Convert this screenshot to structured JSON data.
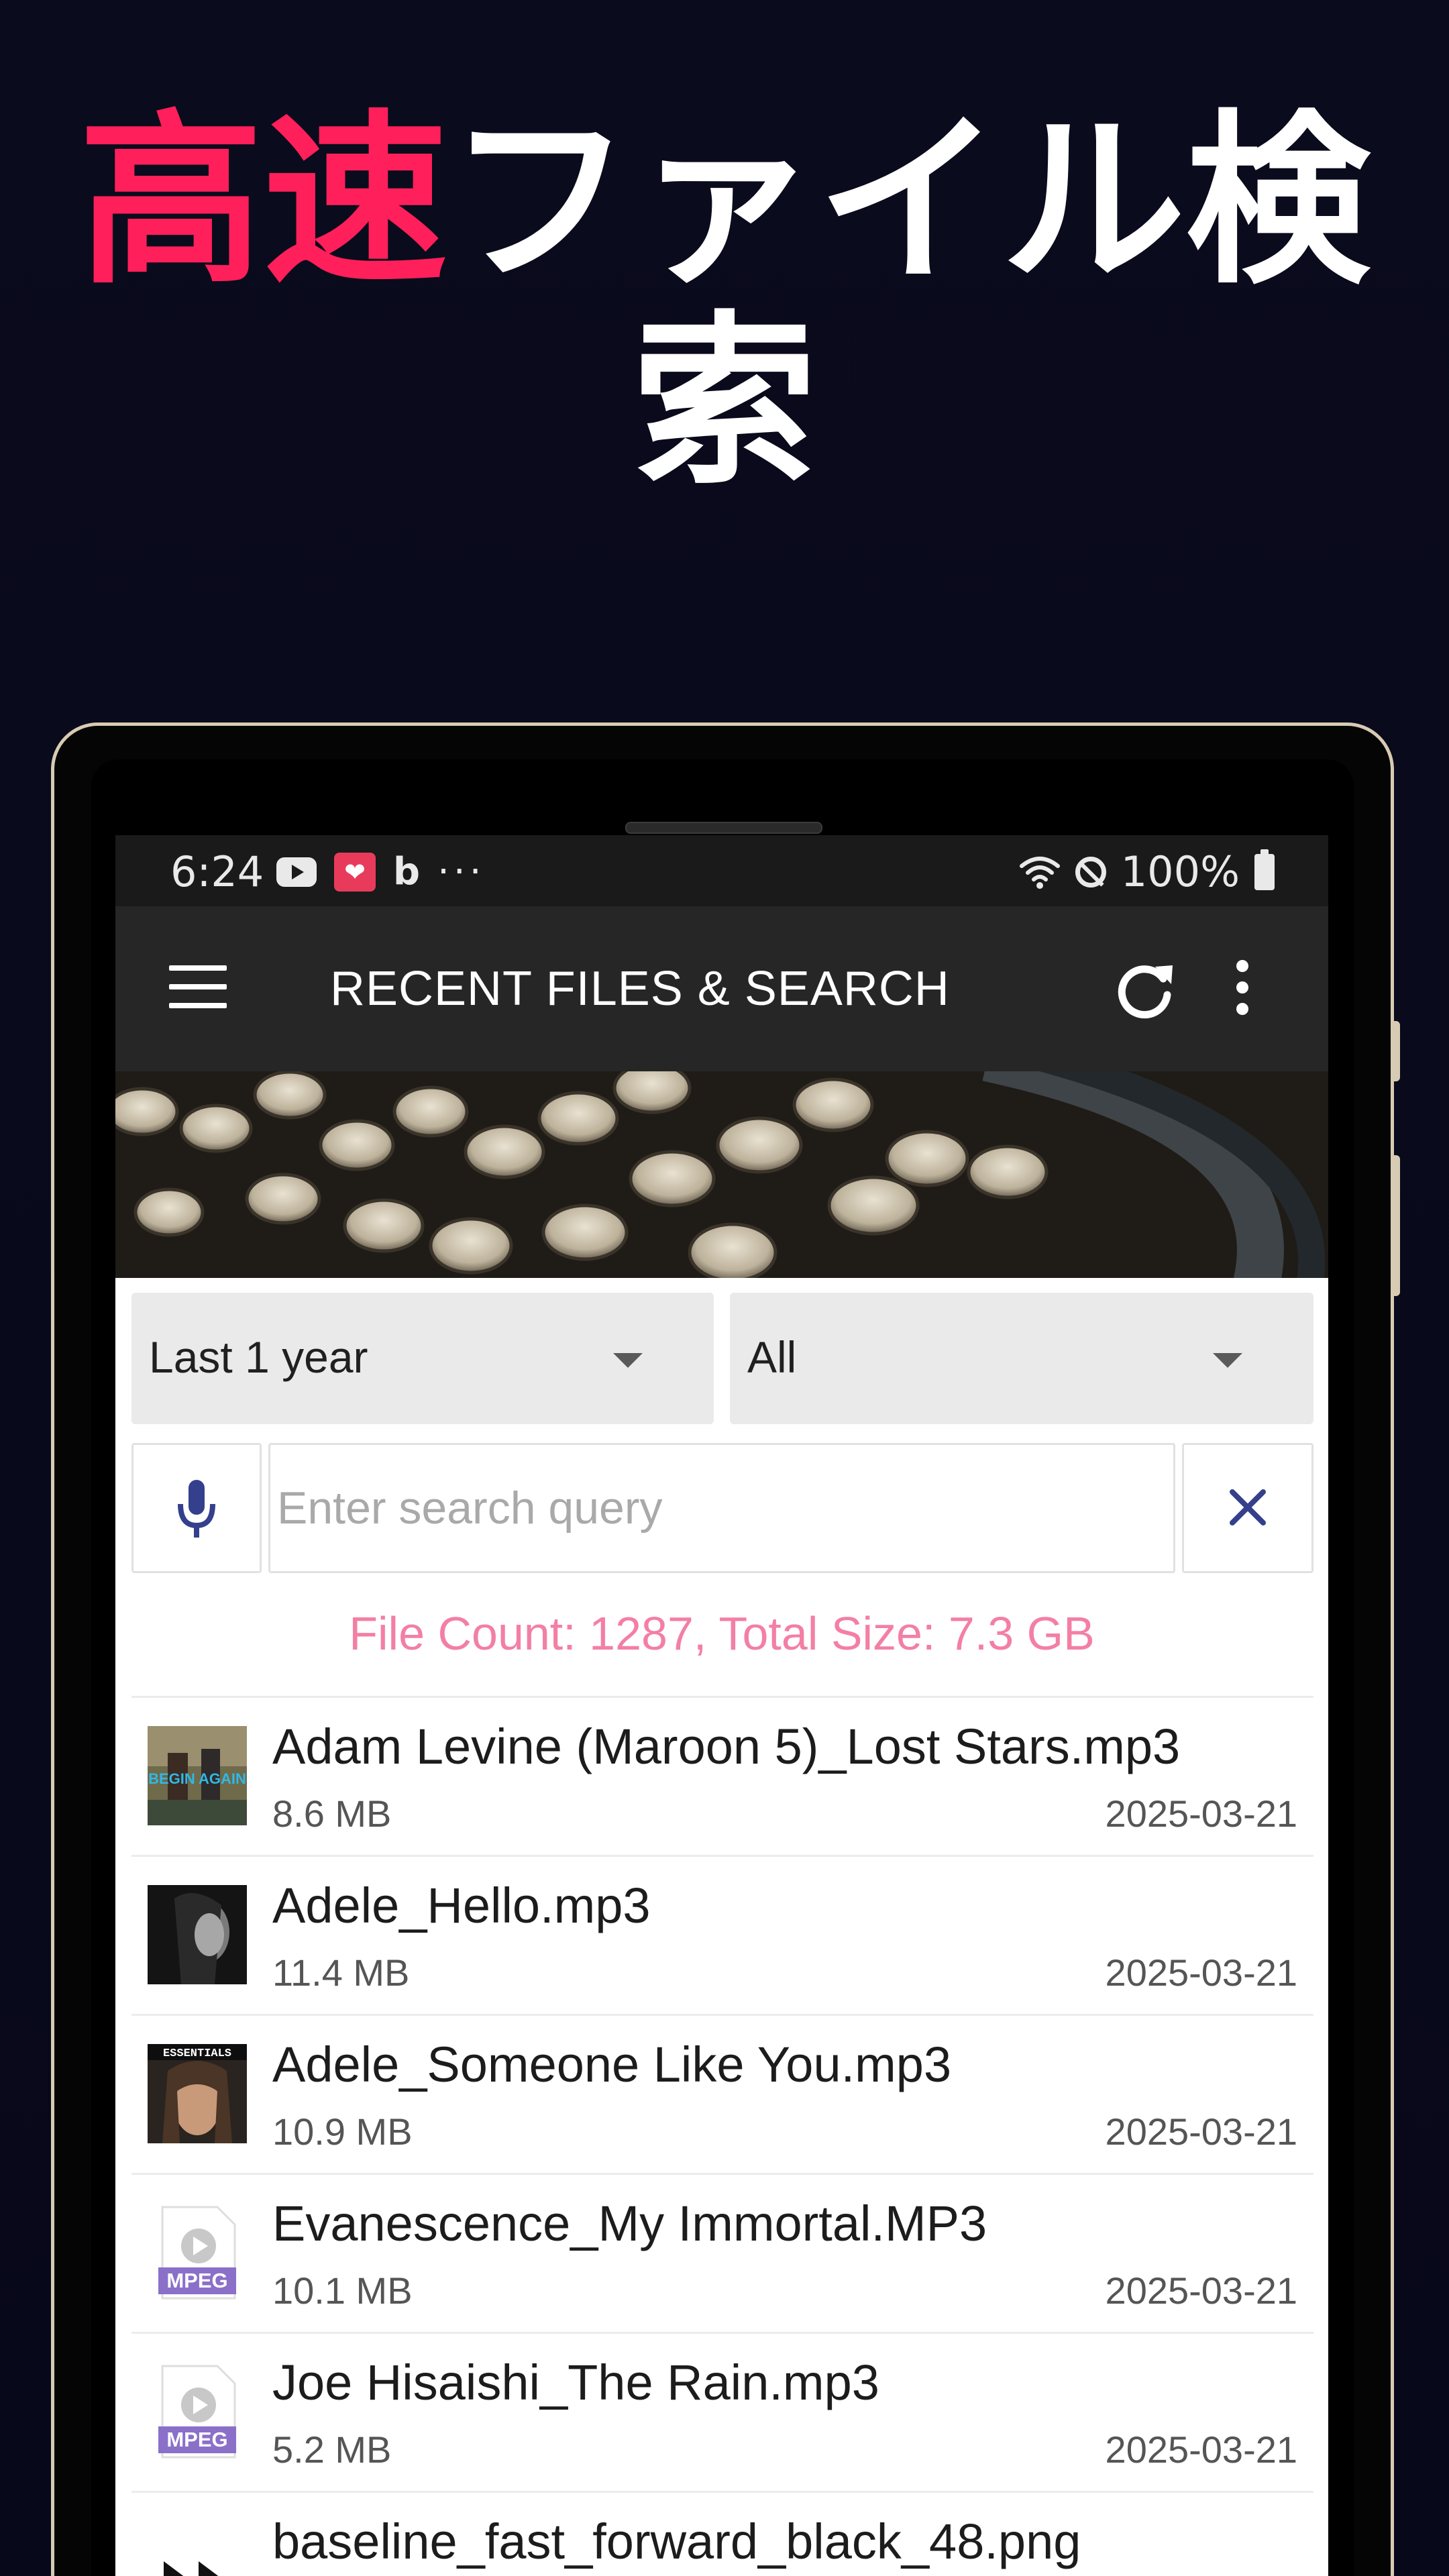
{
  "headline": {
    "accent": "高速",
    "rest_line1": "ファイル検",
    "line2": "索"
  },
  "statusbar": {
    "time": "6:24",
    "battery": "100%",
    "icons": [
      "youtube-icon",
      "heart-app-icon",
      "bing-icon",
      "more-notifications-icon",
      "wifi-icon",
      "do-not-disturb-icon",
      "battery-icon"
    ],
    "more_dots": "···",
    "bing_glyph": "b",
    "heart_glyph": "❤"
  },
  "appbar": {
    "title": "RECENT FILES & SEARCH",
    "icons": [
      "menu-icon",
      "refresh-icon",
      "overflow-menu-icon"
    ]
  },
  "filters": {
    "period": "Last 1 year",
    "type": "All"
  },
  "search": {
    "placeholder": "Enter search query",
    "value": ""
  },
  "stats": {
    "text": "File Count: 1287, Total Size: 7.3 GB"
  },
  "files": [
    {
      "name": "Adam Levine (Maroon 5)_Lost Stars.mp3",
      "size": "8.6 MB",
      "date": "2025-03-21",
      "thumb": "album-cover-begin-again",
      "thumb_text": "BEGIN AGAIN"
    },
    {
      "name": "Adele_Hello.mp3",
      "size": "11.4 MB",
      "date": "2025-03-21",
      "thumb": "album-cover-adele-25",
      "thumb_text": ""
    },
    {
      "name": "Adele_Someone Like You.mp3",
      "size": "10.9 MB",
      "date": "2025-03-21",
      "thumb": "album-cover-essentials",
      "thumb_text": "ESSENTIALS"
    },
    {
      "name": "Evanescence_My Immortal.MP3",
      "size": "10.1 MB",
      "date": "2025-03-21",
      "thumb": "mpeg-file-icon",
      "thumb_text": "MPEG"
    },
    {
      "name": "Joe Hisaishi_The Rain.mp3",
      "size": "5.2 MB",
      "date": "2025-03-21",
      "thumb": "mpeg-file-icon",
      "thumb_text": "MPEG"
    },
    {
      "name": "baseline_fast_forward_black_48.png",
      "size": "",
      "date": "",
      "thumb": "fast-forward-icon",
      "thumb_text": ""
    }
  ],
  "colors": {
    "accent": "#ff1f5a",
    "stats_text": "#f37fa5",
    "appbar": "#262626",
    "statusbar": "#1a1a1a",
    "icon_blue": "#34408c"
  }
}
